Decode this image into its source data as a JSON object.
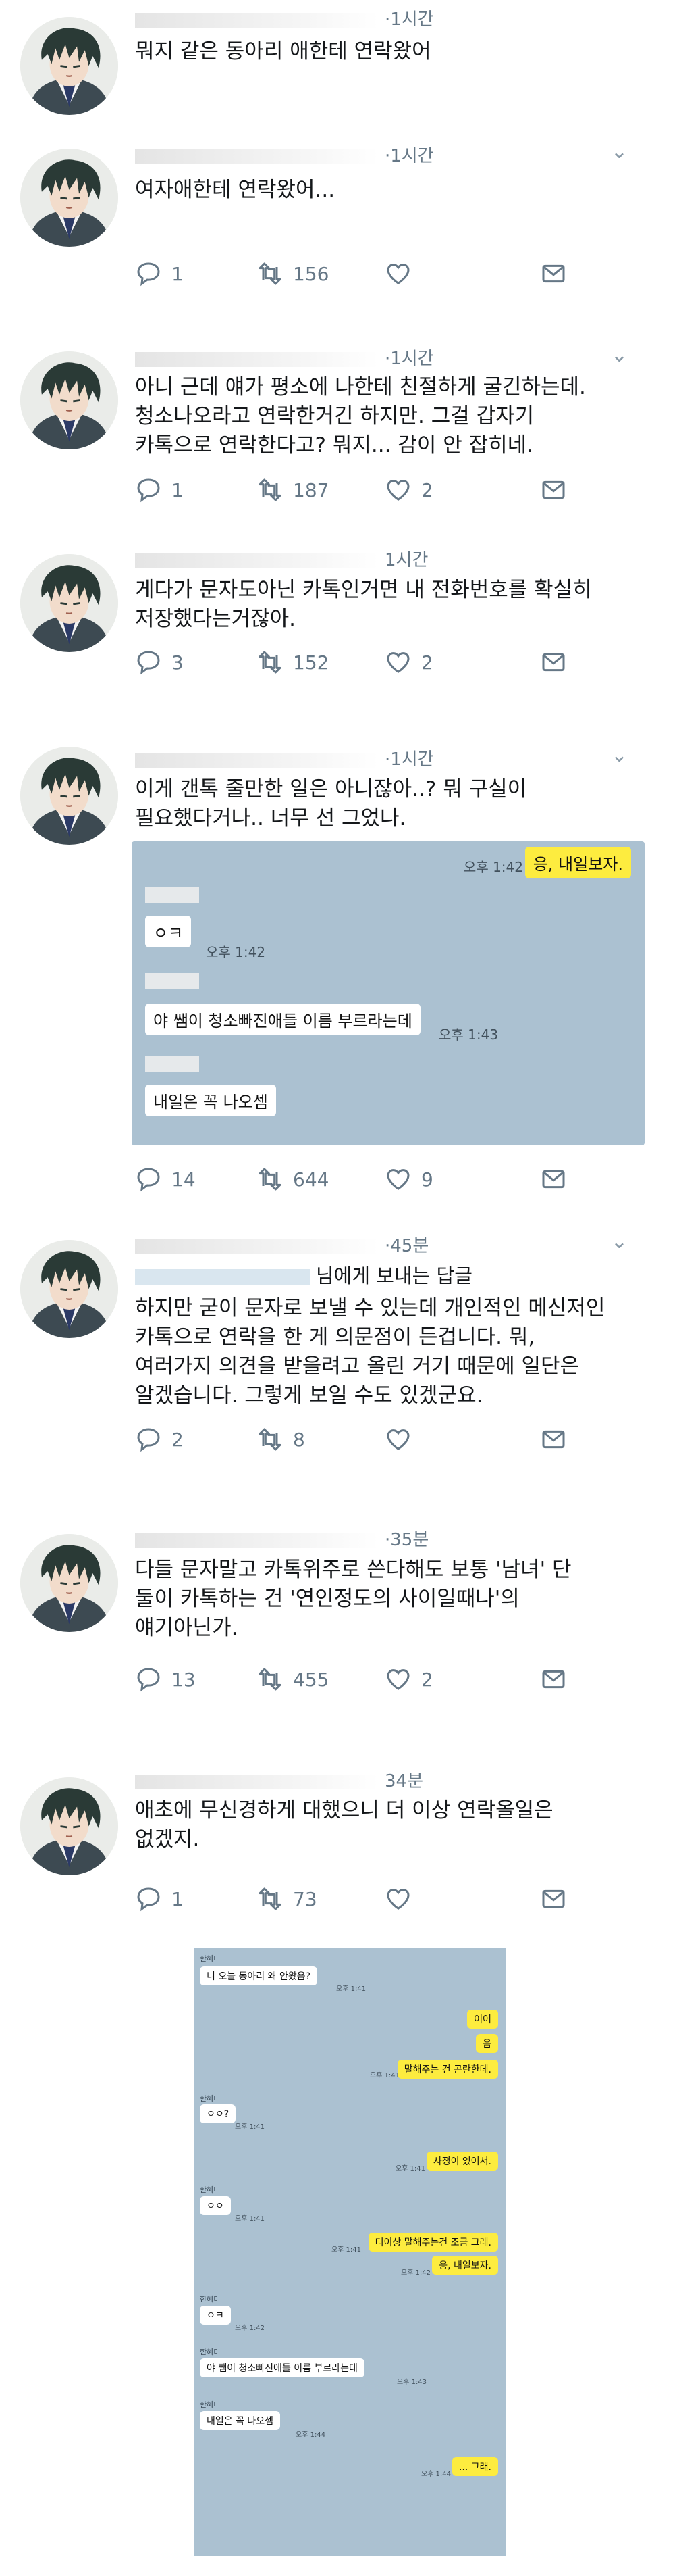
{
  "tweets": [
    {
      "time": "·1시간",
      "text": "뭐지 같은 동아리 애한테 연락왔어"
    },
    {
      "time": "·1시간",
      "text": "여자애한테 연락왔어...",
      "actions": {
        "reply": "1",
        "retweet": "156"
      }
    },
    {
      "time": "·1시간",
      "text": "아니 근데 얘가 평소에 나한테 친절하게 굴긴하는데.\n청소나오라고 연락한거긴 하지만. 그걸 갑자기\n카톡으로 연락한다고? 뭐지... 감이 안 잡히네.",
      "actions": {
        "reply": "1",
        "retweet": "187",
        "like": "2"
      }
    },
    {
      "time": "1시간",
      "text": "게다가 문자도아닌 카톡인거면 내 전화번호를 확실히\n저장했다는거잖아.",
      "actions": {
        "reply": "3",
        "retweet": "152",
        "like": "2"
      }
    },
    {
      "time": "·1시간",
      "text": "이게 갠톡 줄만한 일은 아니잖아..? 뭐 구실이\n필요했다거나.. 너무 선 그었나.",
      "actions": {
        "reply": "14",
        "retweet": "644",
        "like": "9"
      }
    },
    {
      "time": "·45분",
      "reply_suffix": "님에게 보내는 답글",
      "text": "하지만 굳이 문자로 보낼 수 있는데 개인적인 메신저인\n카톡으로 연락을 한 게 의문점이 든겁니다. 뭐,\n여러가지 의견을 받을려고 올린 거기 때문에 일단은\n알겠습니다. 그렇게 보일 수도 있겠군요.",
      "actions": {
        "reply": "2",
        "retweet": "8"
      }
    },
    {
      "time": "·35분",
      "text": "다들 문자말고 카톡위주로 쓴다해도 보통 '남녀' 단\n둘이 카톡하는 건 '연인정도의 사이일때나'의\n얘기아닌가.",
      "actions": {
        "reply": "13",
        "retweet": "455",
        "like": "2"
      }
    },
    {
      "time": "34분",
      "text": "애초에 무신경하게 대했으니 더 이상 연락올일은\n없겠지.",
      "actions": {
        "reply": "1",
        "retweet": "73"
      }
    }
  ],
  "chat_small": {
    "msgs": [
      {
        "text": "응, 내일보자.",
        "time": "오후 1:42"
      },
      {
        "text": "ㅇㅋ",
        "time": "오후 1:42"
      },
      {
        "text": "야 쌤이 청소빠진애들 이름 부르라는데",
        "time": "오후 1:43"
      },
      {
        "text": "내일은 꼭 나오셈"
      }
    ]
  },
  "chat_big": {
    "sender": "한혜미",
    "msgs": [
      {
        "text": "니 오늘 동아리 왜 안왔음?",
        "time": "오후 1:41"
      },
      {
        "text": "어어"
      },
      {
        "text": "음"
      },
      {
        "text": "말해주는 건 곤란한데.",
        "time": "오후 1:41"
      },
      {
        "text": "ㅇㅇ?",
        "time": "오후 1:41"
      },
      {
        "text": "사정이 있어서.",
        "time": "오후 1:41"
      },
      {
        "text": "ㅇㅇ",
        "time": "오후 1:41"
      },
      {
        "text": "더이상 말해주는건 조금 그래.",
        "time": "오후 1:41"
      },
      {
        "text": "응, 내일보자.",
        "time": "오후 1:42"
      },
      {
        "text": "ㅇㅋ",
        "time": "오후 1:42"
      },
      {
        "text": "야 쌤이 청소빠진애들 이름 부르라는데",
        "time": "오후 1:43"
      },
      {
        "text": "내일은 꼭 나오셈",
        "time": "오후 1:44"
      },
      {
        "text": "... 그래.",
        "time": "오후 1:44"
      }
    ]
  },
  "icons": {
    "reply": "reply-icon",
    "retweet": "retweet-icon",
    "like": "heart-icon",
    "message": "envelope-icon",
    "caret": "chevron-down-icon"
  },
  "colors": {
    "gray": "#657786",
    "chat_bg": "#abc1d1",
    "bubble_out": "#fdec3f"
  }
}
